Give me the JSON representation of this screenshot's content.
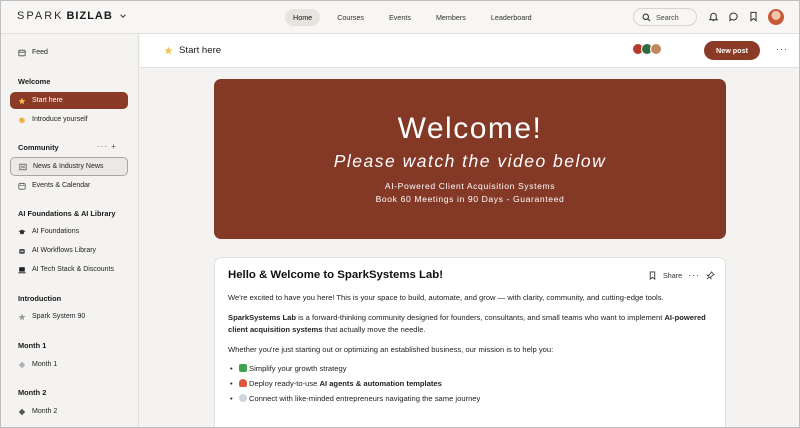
{
  "header": {
    "logo_left": "SPARK",
    "logo_right": "BIZLAB",
    "nav": [
      {
        "label": "Home",
        "active": true
      },
      {
        "label": "Courses",
        "active": false
      },
      {
        "label": "Events",
        "active": false
      },
      {
        "label": "Members",
        "active": false
      },
      {
        "label": "Leaderboard",
        "active": false
      }
    ],
    "search_label": "Search"
  },
  "sidebar": {
    "feed": "Feed",
    "welcome_heading": "Welcome",
    "start_here": "Start here",
    "introduce": "Introduce yourself",
    "community_heading": "Community",
    "community_tools": "··· +",
    "news": "News & Industry News",
    "events": "Events & Calendar",
    "foundations_heading": "AI Foundations & AI Library",
    "foundations": "AI Foundations",
    "workflows": "AI Workflows Library",
    "techstack": "AI Tech Stack & Discounts",
    "intro_heading": "Introduction",
    "spark90": "Spark System 90",
    "month1_heading": "Month 1",
    "month1": "Month 1",
    "month2_heading": "Month 2",
    "month2": "Month 2"
  },
  "main": {
    "title": "Start here",
    "new_post": "New post",
    "banner": {
      "title": "Welcome!",
      "subtitle": "Please watch the video below",
      "line1": "AI-Powered Client Acquisition Systems",
      "line2": "Book 60 Meetings in 90 Days - Guaranteed"
    },
    "post": {
      "title": "Hello & Welcome to SparkSystems Lab!",
      "share": "Share",
      "p1": "We're excited to have you here! This is your space to build, automate, and grow — with clarity, community, and cutting-edge tools.",
      "p2_bold": "SparkSystems Lab",
      "p2_mid": " is a forward-thinking community designed for founders, consultants, and small teams who want to implement ",
      "p2_bold2": "AI-powered client acquisition systems",
      "p2_end": " that actually move the needle.",
      "p3": "Whether you're just starting out or optimizing an established business, our mission is to help you:",
      "b1": "Simplify your growth strategy",
      "b2_pre": "Deploy ready-to-use ",
      "b2_bold": "AI agents & automation templates",
      "b3": "Connect with like-minded entrepreneurs navigating the same journey"
    }
  },
  "colors": {
    "accent": "#8a3a26",
    "banner": "#843826"
  }
}
